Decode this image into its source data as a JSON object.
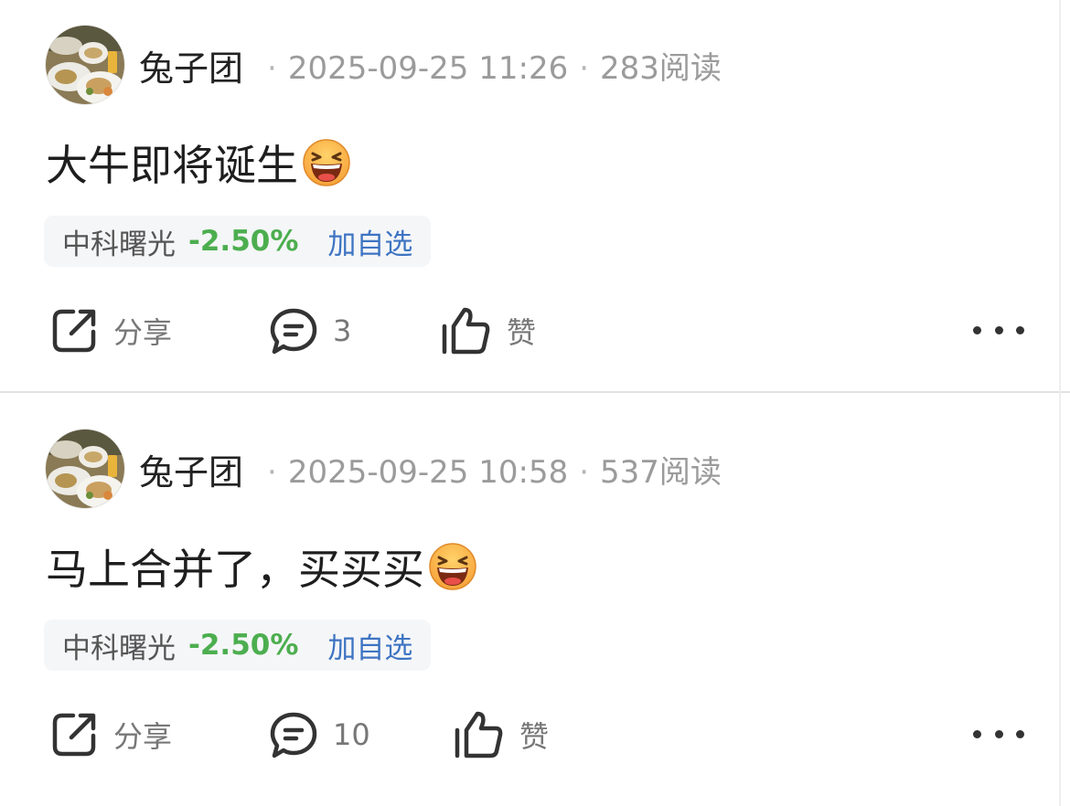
{
  "posts": [
    {
      "author": "兔子团",
      "datetime": "2025-09-25 11:26",
      "reads": "283阅读",
      "text": "大牛即将诞生",
      "emoji": "laughing-emoji",
      "stock": {
        "name": "中科曙光",
        "change": "-2.50%",
        "add_label": "加自选"
      },
      "actions": {
        "share": "分享",
        "comments": "3",
        "like": "赞"
      }
    },
    {
      "author": "兔子团",
      "datetime": "2025-09-25 10:58",
      "reads": "537阅读",
      "text": "马上合并了，买买买",
      "emoji": "laughing-emoji",
      "stock": {
        "name": "中科曙光",
        "change": "-2.50%",
        "add_label": "加自选"
      },
      "actions": {
        "share": "分享",
        "comments": "10",
        "like": "赞"
      }
    }
  ],
  "separator": "·",
  "colors": {
    "text": "#1e1e1e",
    "meta": "#9b9b9b",
    "stock_down": "#4cae4f",
    "add_link": "#3e74c2",
    "tag_background": "#f5f6f8"
  }
}
